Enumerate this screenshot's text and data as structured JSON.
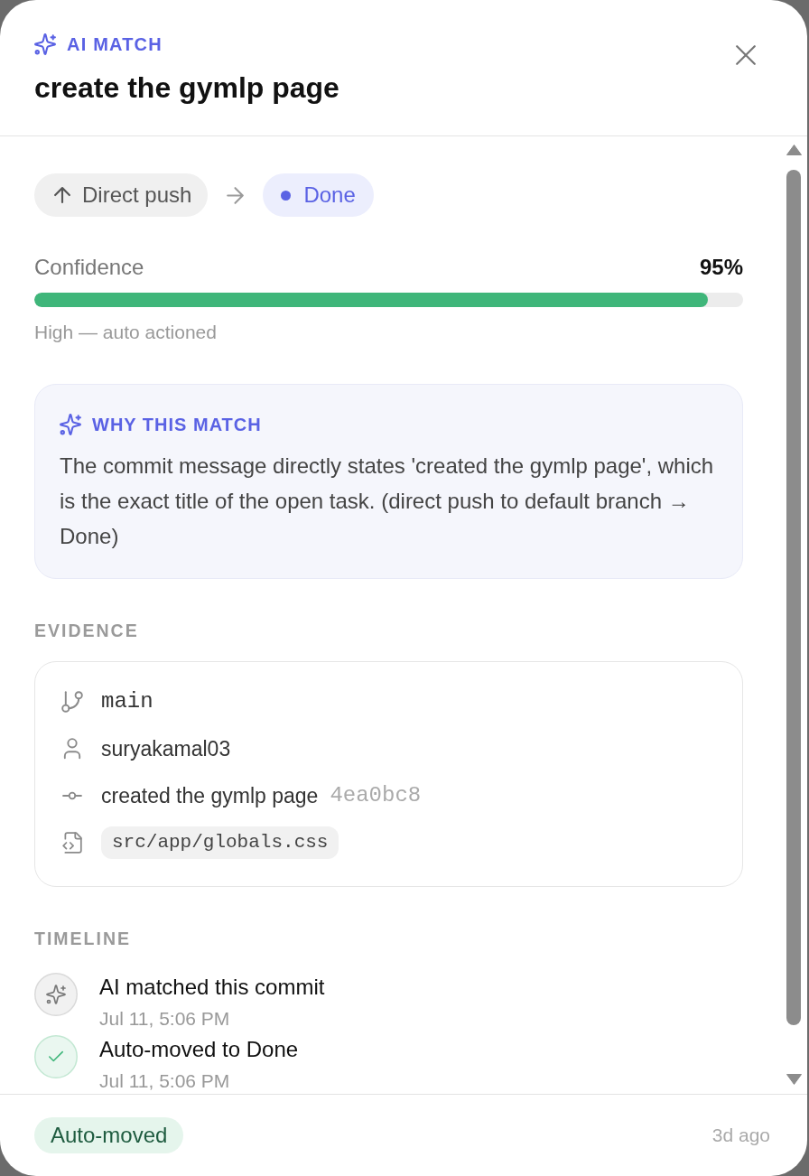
{
  "header": {
    "eyebrow": "AI MATCH",
    "title": "create the gymlp page"
  },
  "transition": {
    "from": {
      "label": "Direct push"
    },
    "to": {
      "label": "Done"
    }
  },
  "confidence": {
    "label": "Confidence",
    "value": "95%",
    "level": 0.95,
    "note": "High — auto actioned"
  },
  "explanation": {
    "heading": "WHY THIS MATCH",
    "text": "The commit message directly states 'created the gymlp page', which is the exact title of the open task. (direct push to default branch → Done)"
  },
  "evidence": {
    "heading": "EVIDENCE",
    "items": [
      {
        "kind": "branch",
        "text": "main"
      },
      {
        "kind": "author",
        "text": "suryakamal03"
      },
      {
        "kind": "commit",
        "text": "created the gymlp page",
        "hash": "4ea0bc8"
      },
      {
        "kind": "file",
        "text": "src/app/globals.css"
      }
    ]
  },
  "timeline": {
    "heading": "TIMELINE",
    "events": [
      {
        "kind": "ai",
        "title": "AI matched this commit",
        "time": "Jul 11, 5:06 PM"
      },
      {
        "kind": "moved",
        "title": "Auto-moved to Done",
        "time": "Jul 11, 5:06 PM"
      }
    ]
  },
  "footer": {
    "status": "Auto-moved",
    "time": "3d ago"
  }
}
